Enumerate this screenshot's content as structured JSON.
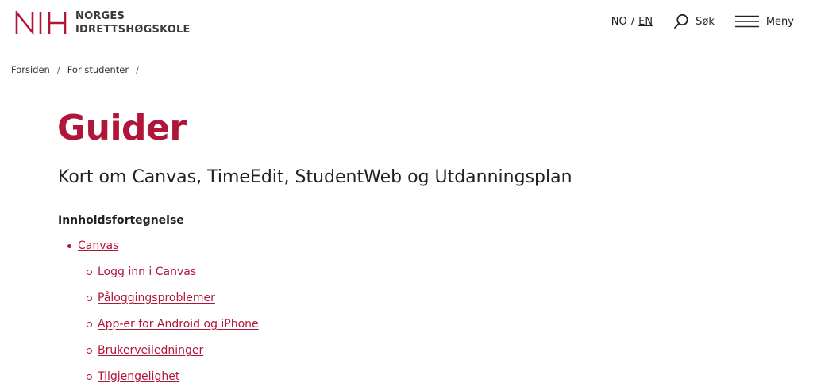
{
  "header": {
    "logo_line1": "NORGES",
    "logo_line2": "IDRETTSHØGSKOLE",
    "lang_active": "NO",
    "lang_separator": "/",
    "lang_other": "EN",
    "search_label": "Søk",
    "menu_label": "Meny"
  },
  "breadcrumb": {
    "items": [
      "Forsiden",
      "For studenter"
    ],
    "separator": "/"
  },
  "main": {
    "title": "Guider",
    "lead": "Kort om Canvas, TimeEdit, StudentWeb og Utdanningsplan",
    "toc_heading": "Innholdsfortegnelse",
    "toc": [
      {
        "label": "Canvas",
        "children": [
          "Logg inn i Canvas",
          "Påloggingsproblemer",
          "App-er for Android og iPhone",
          "Brukerveiledninger",
          "Tilgjengelighet"
        ]
      }
    ]
  },
  "colors": {
    "brand": "#b0163a",
    "text": "#222222",
    "background": "#ffffff"
  },
  "icons": {
    "logo": "nih-logo-icon",
    "search": "search-icon",
    "menu": "hamburger-menu-icon"
  }
}
